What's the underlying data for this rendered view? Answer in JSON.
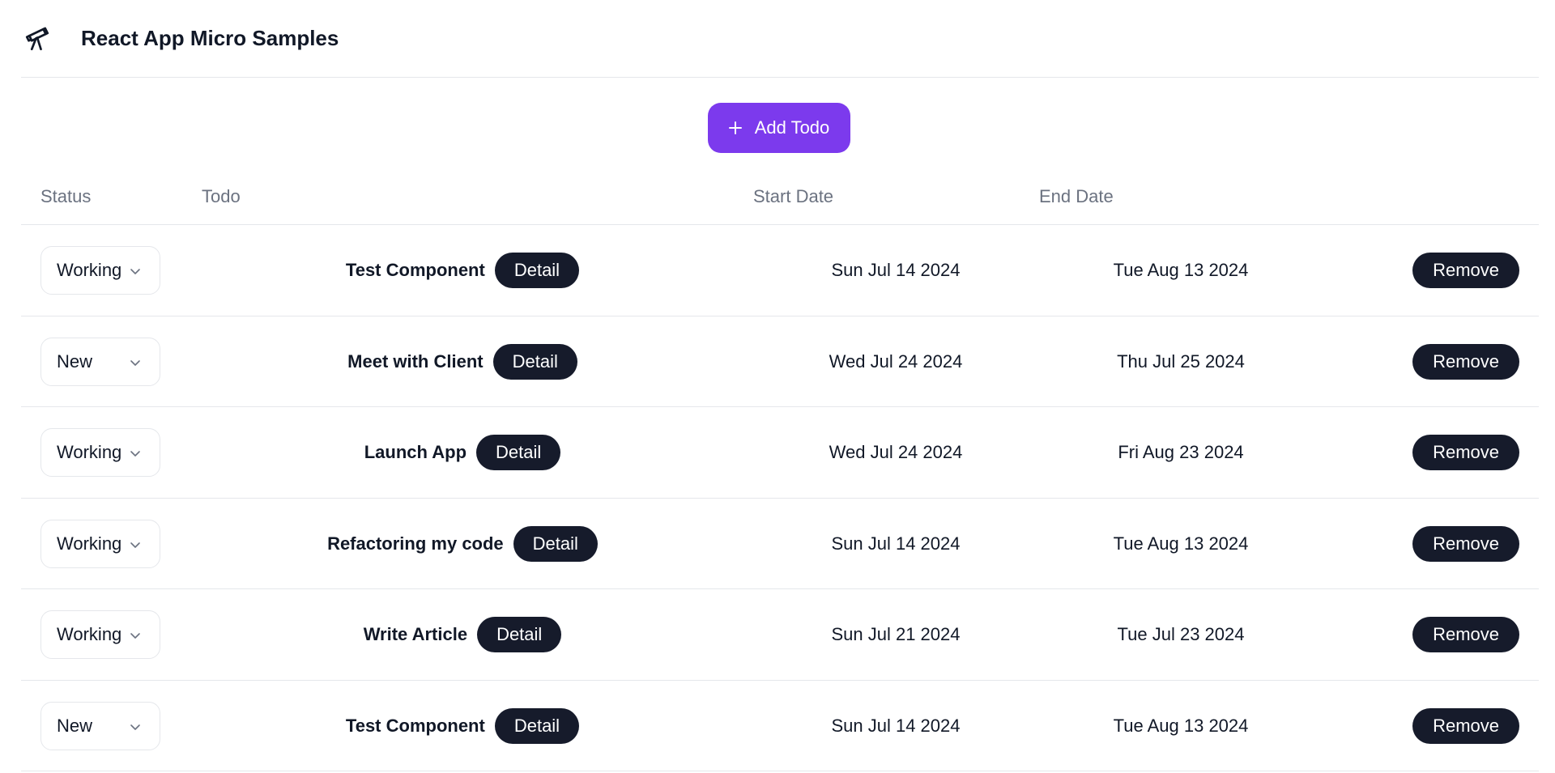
{
  "header": {
    "logo_icon": "telescope-icon",
    "title": "React App Micro Samples"
  },
  "toolbar": {
    "add_label": "Add Todo",
    "add_icon": "plus-icon",
    "accent": "#7c3aed"
  },
  "table": {
    "columns": {
      "status": "Status",
      "todo": "Todo",
      "start": "Start Date",
      "end": "End Date"
    },
    "detail_label": "Detail",
    "remove_label": "Remove",
    "rows": [
      {
        "status": "Working",
        "title": "Test Component",
        "start": "Sun Jul 14 2024",
        "end": "Tue Aug 13 2024"
      },
      {
        "status": "New",
        "title": "Meet with Client",
        "start": "Wed Jul 24 2024",
        "end": "Thu Jul 25 2024"
      },
      {
        "status": "Working",
        "title": "Launch App",
        "start": "Wed Jul 24 2024",
        "end": "Fri Aug 23 2024"
      },
      {
        "status": "Working",
        "title": "Refactoring my code",
        "start": "Sun Jul 14 2024",
        "end": "Tue Aug 13 2024"
      },
      {
        "status": "Working",
        "title": "Write Article",
        "start": "Sun Jul 21 2024",
        "end": "Tue Jul 23 2024"
      },
      {
        "status": "New",
        "title": "Test Component",
        "start": "Sun Jul 14 2024",
        "end": "Tue Aug 13 2024"
      }
    ]
  }
}
